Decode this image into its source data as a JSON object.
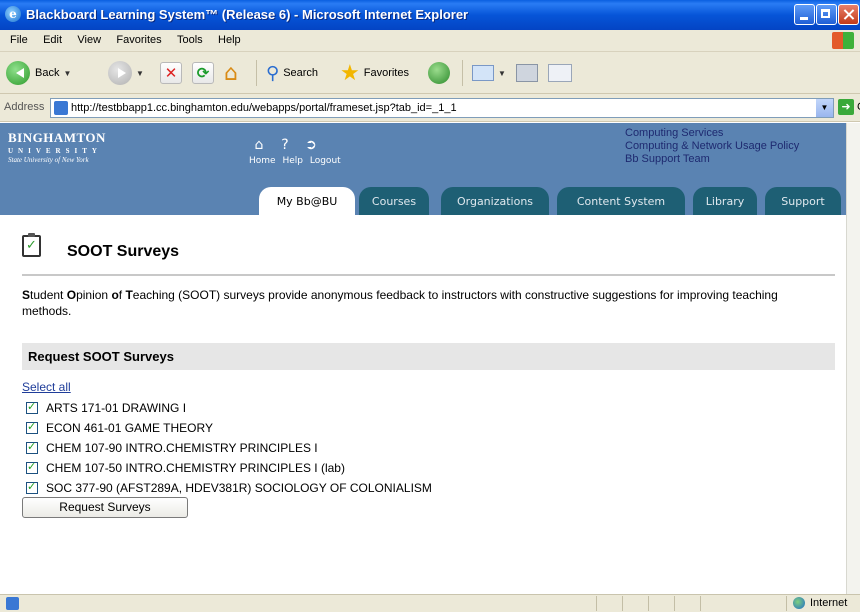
{
  "window": {
    "title": "Blackboard Learning System™ (Release 6) - Microsoft Internet Explorer"
  },
  "menu": [
    "File",
    "Edit",
    "View",
    "Favorites",
    "Tools",
    "Help"
  ],
  "toolbar": {
    "back_label": "Back",
    "search_label": "Search",
    "favorites_label": "Favorites"
  },
  "address": {
    "label": "Address",
    "url": "http://testbbapp1.cc.binghamton.edu/webapps/portal/frameset.jsp?tab_id=_1_1",
    "go_label": "Go"
  },
  "header": {
    "logo_line1": "BINGHAMTON",
    "logo_line2": "UNIVERSITY",
    "logo_line3": "State University of New York",
    "nav_home": "Home",
    "nav_help": "Help",
    "nav_logout": "Logout",
    "links": [
      "Computing Services",
      "Computing & Network Usage Policy",
      "Bb Support Team"
    ]
  },
  "tabs": [
    "My Bb@BU",
    "Courses",
    "Organizations",
    "Content System",
    "Library",
    "Support"
  ],
  "page": {
    "title": "SOOT Surveys",
    "intro_S": "S",
    "intro_1": "tudent ",
    "intro_O": "O",
    "intro_2": "pinion ",
    "intro_of": "o",
    "intro_3": "f ",
    "intro_T": "T",
    "intro_4": "eaching (SOOT) surveys provide anonymous feedback to instructors with constructive suggestions for improving teaching methods.",
    "section_title": "Request SOOT Surveys",
    "select_all": "Select all",
    "courses": [
      "ARTS 171-01 DRAWING I",
      "ECON 461-01 GAME THEORY",
      "CHEM 107-90 INTRO.CHEMISTRY PRINCIPLES I",
      "CHEM 107-50 INTRO.CHEMISTRY PRINCIPLES I (lab)",
      "SOC 377-90 (AFST289A, HDEV381R) SOCIOLOGY OF COLONIALISM"
    ],
    "courses_checked": [
      true,
      true,
      true,
      true,
      true
    ],
    "button": "Request Surveys"
  },
  "status": {
    "zone": "Internet"
  },
  "colors": {
    "header_blue": "#5a83b2",
    "tab_teal": "#1e5f74",
    "titlebar_blue": "#0655d8"
  }
}
